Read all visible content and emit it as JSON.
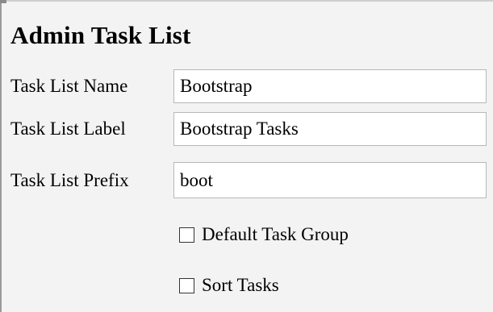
{
  "form": {
    "title": "Admin Task List",
    "fields": {
      "name": {
        "label": "Task List Name",
        "value": "Bootstrap"
      },
      "label": {
        "label": "Task List Label",
        "value": "Bootstrap Tasks"
      },
      "prefix": {
        "label": "Task List Prefix",
        "value": "boot"
      }
    },
    "checkboxes": {
      "default_task_group": {
        "label": "Default Task Group",
        "checked": false
      },
      "sort_tasks": {
        "label": "Sort Tasks",
        "checked": false
      }
    }
  }
}
